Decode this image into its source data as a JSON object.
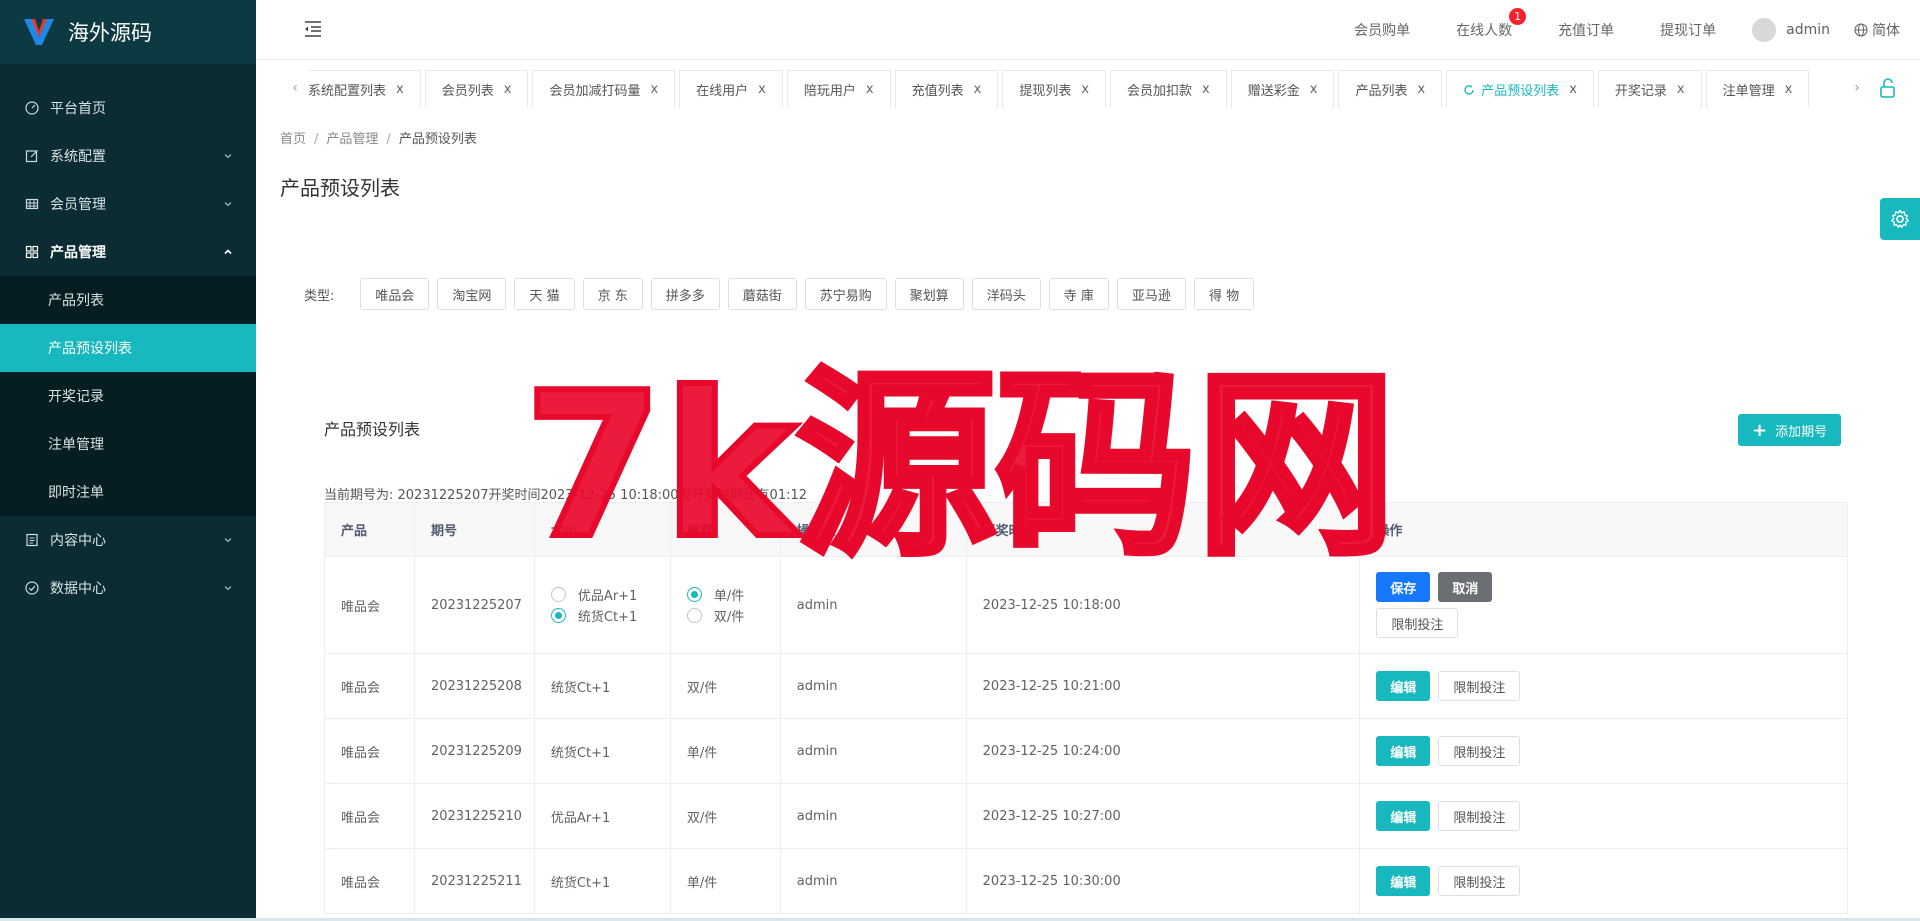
{
  "brand": {
    "name": "海外源码"
  },
  "sidebar": {
    "items": [
      {
        "label": "平台首页",
        "icon": "dashboard-icon",
        "expandable": false
      },
      {
        "label": "系统配置",
        "icon": "edit-icon",
        "expandable": true
      },
      {
        "label": "会员管理",
        "icon": "table-icon",
        "expandable": true
      },
      {
        "label": "产品管理",
        "icon": "grid-icon",
        "expandable": true,
        "open": true,
        "children": [
          "产品列表",
          "产品预设列表",
          "开奖记录",
          "注单管理",
          "即时注单"
        ],
        "active_child": 1
      },
      {
        "label": "内容中心",
        "icon": "document-icon",
        "expandable": true
      },
      {
        "label": "数据中心",
        "icon": "check-circle-icon",
        "expandable": true
      }
    ]
  },
  "header": {
    "links": [
      "会员购单",
      "在线人数",
      "充值订单",
      "提现订单"
    ],
    "online_badge": "1",
    "user": "admin",
    "lang": "简体"
  },
  "tabs": {
    "items": [
      "系统配置列表",
      "会员列表",
      "会员加减打码量",
      "在线用户",
      "陪玩用户",
      "充值列表",
      "提现列表",
      "会员加扣款",
      "赠送彩金",
      "产品列表",
      "产品预设列表",
      "开奖记录",
      "注单管理"
    ],
    "active": 10,
    "close": "x"
  },
  "breadcrumb": {
    "home": "首页",
    "parent": "产品管理",
    "current": "产品预设列表"
  },
  "page": {
    "title": "产品预设列表"
  },
  "filter": {
    "label": "类型:",
    "types": [
      "唯品会",
      "淘宝网",
      "天 猫",
      "京 东",
      "拼多多",
      "蘑菇街",
      "苏宁易购",
      "聚划算",
      "洋码头",
      "寺 庫",
      "亚马逊",
      "得 物"
    ]
  },
  "card": {
    "title": "产品预设列表",
    "add_label": "添加期号"
  },
  "period_info": "当前期号为: 20231225207开奖时间2023-12-25 10:18:00距开奖时间还有01:12",
  "table": {
    "columns": [
      "产品",
      "期号",
      "大小",
      "单双",
      "操作人",
      "开奖时间",
      "操作"
    ],
    "rows": [
      {
        "product": "唯品会",
        "period": "20231225207",
        "size": "",
        "odd": "",
        "operator": "admin",
        "time": "2023-12-25 10:18:00",
        "editing": true
      },
      {
        "product": "唯品会",
        "period": "20231225208",
        "size": "统货Ct+1",
        "odd": "双/件",
        "operator": "admin",
        "time": "2023-12-25 10:21:00"
      },
      {
        "product": "唯品会",
        "period": "20231225209",
        "size": "统货Ct+1",
        "odd": "单/件",
        "operator": "admin",
        "time": "2023-12-25 10:24:00"
      },
      {
        "product": "唯品会",
        "period": "20231225210",
        "size": "优品Ar+1",
        "odd": "双/件",
        "operator": "admin",
        "time": "2023-12-25 10:27:00"
      },
      {
        "product": "唯品会",
        "period": "20231225211",
        "size": "统货Ct+1",
        "odd": "单/件",
        "operator": "admin",
        "time": "2023-12-25 10:30:00"
      }
    ],
    "edit_options": {
      "size": [
        {
          "label": "优品Ar+1",
          "checked": false
        },
        {
          "label": "统货Ct+1",
          "checked": true
        }
      ],
      "odd": [
        {
          "label": "单/件",
          "checked": true
        },
        {
          "label": "双/件",
          "checked": false
        }
      ]
    },
    "buttons": {
      "save": "保存",
      "cancel": "取消",
      "edit": "编辑",
      "limit": "限制投注"
    }
  },
  "watermark": {
    "text": "7k源码网"
  },
  "colors": {
    "accent": "#17b8be",
    "sidebar_bg": "#0b2c33",
    "watermark": "#e8082b",
    "primary_blue": "#1677ff"
  }
}
